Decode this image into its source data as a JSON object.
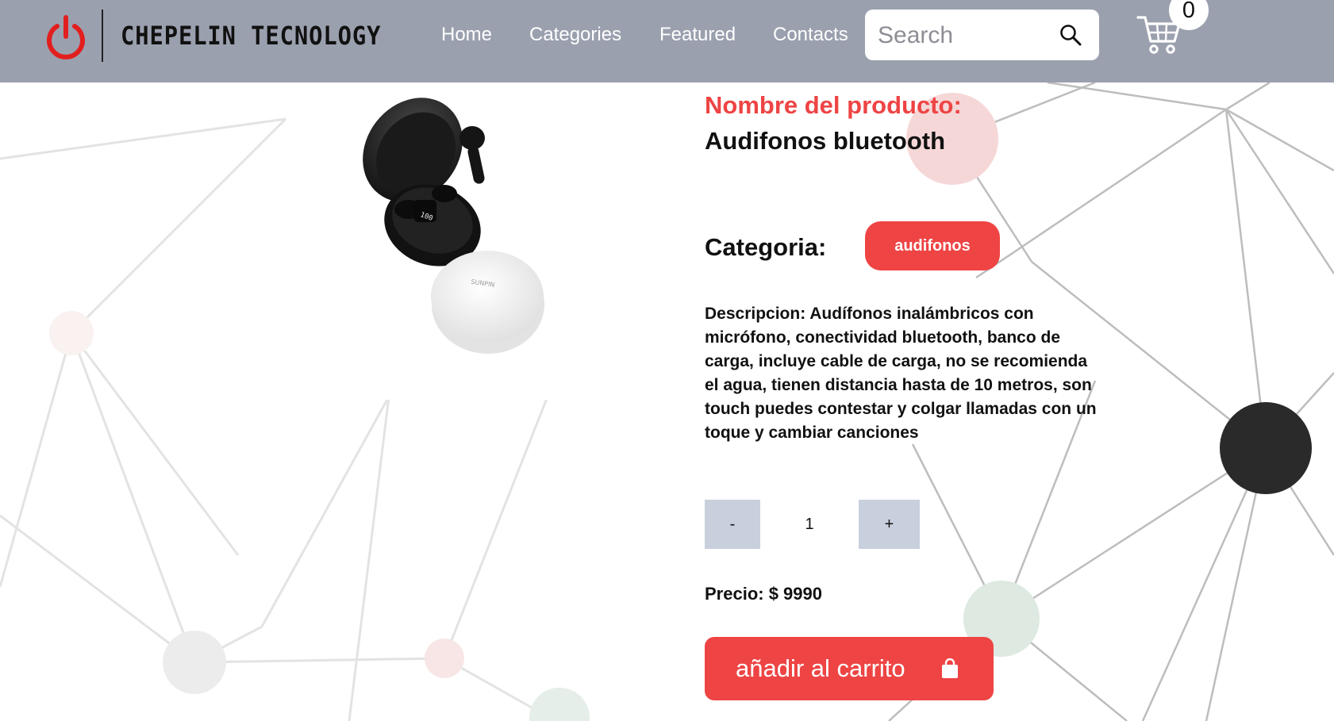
{
  "header": {
    "brand_name": "CHEPELIN TECNOLOGY",
    "nav": [
      "Home",
      "Categories",
      "Featured",
      "Contacts"
    ],
    "search_placeholder": "Search",
    "cart_count": "0"
  },
  "product": {
    "name_label": "Nombre del producto:",
    "name_value": "Audifonos bluetooth",
    "category_label": "Categoria:",
    "category_value": "audifonos",
    "description": "Descripcion: Audífonos inalámbricos con micrófono, conectividad bluetooth, banco de carga, incluye cable de carga, no se recomienda el agua, tienen distancia hasta de 10 metros, son touch puedes contestar y colgar llamadas con un toque y cambiar canciones",
    "quantity": "1",
    "minus_label": "-",
    "plus_label": "+",
    "price": "Precio: $ 9990",
    "add_to_cart_label": "añadir al carrito",
    "case_print": "SUNPIN",
    "display_digits": "100"
  },
  "icons": {
    "brand": "power-icon",
    "search": "search-icon",
    "cart": "cart-icon",
    "add_to_cart": "shopping-bag-icon"
  },
  "colors": {
    "header_bg": "#9aa0ae",
    "accent": "#ee4444",
    "qty_button_bg": "#c8d0dd"
  }
}
